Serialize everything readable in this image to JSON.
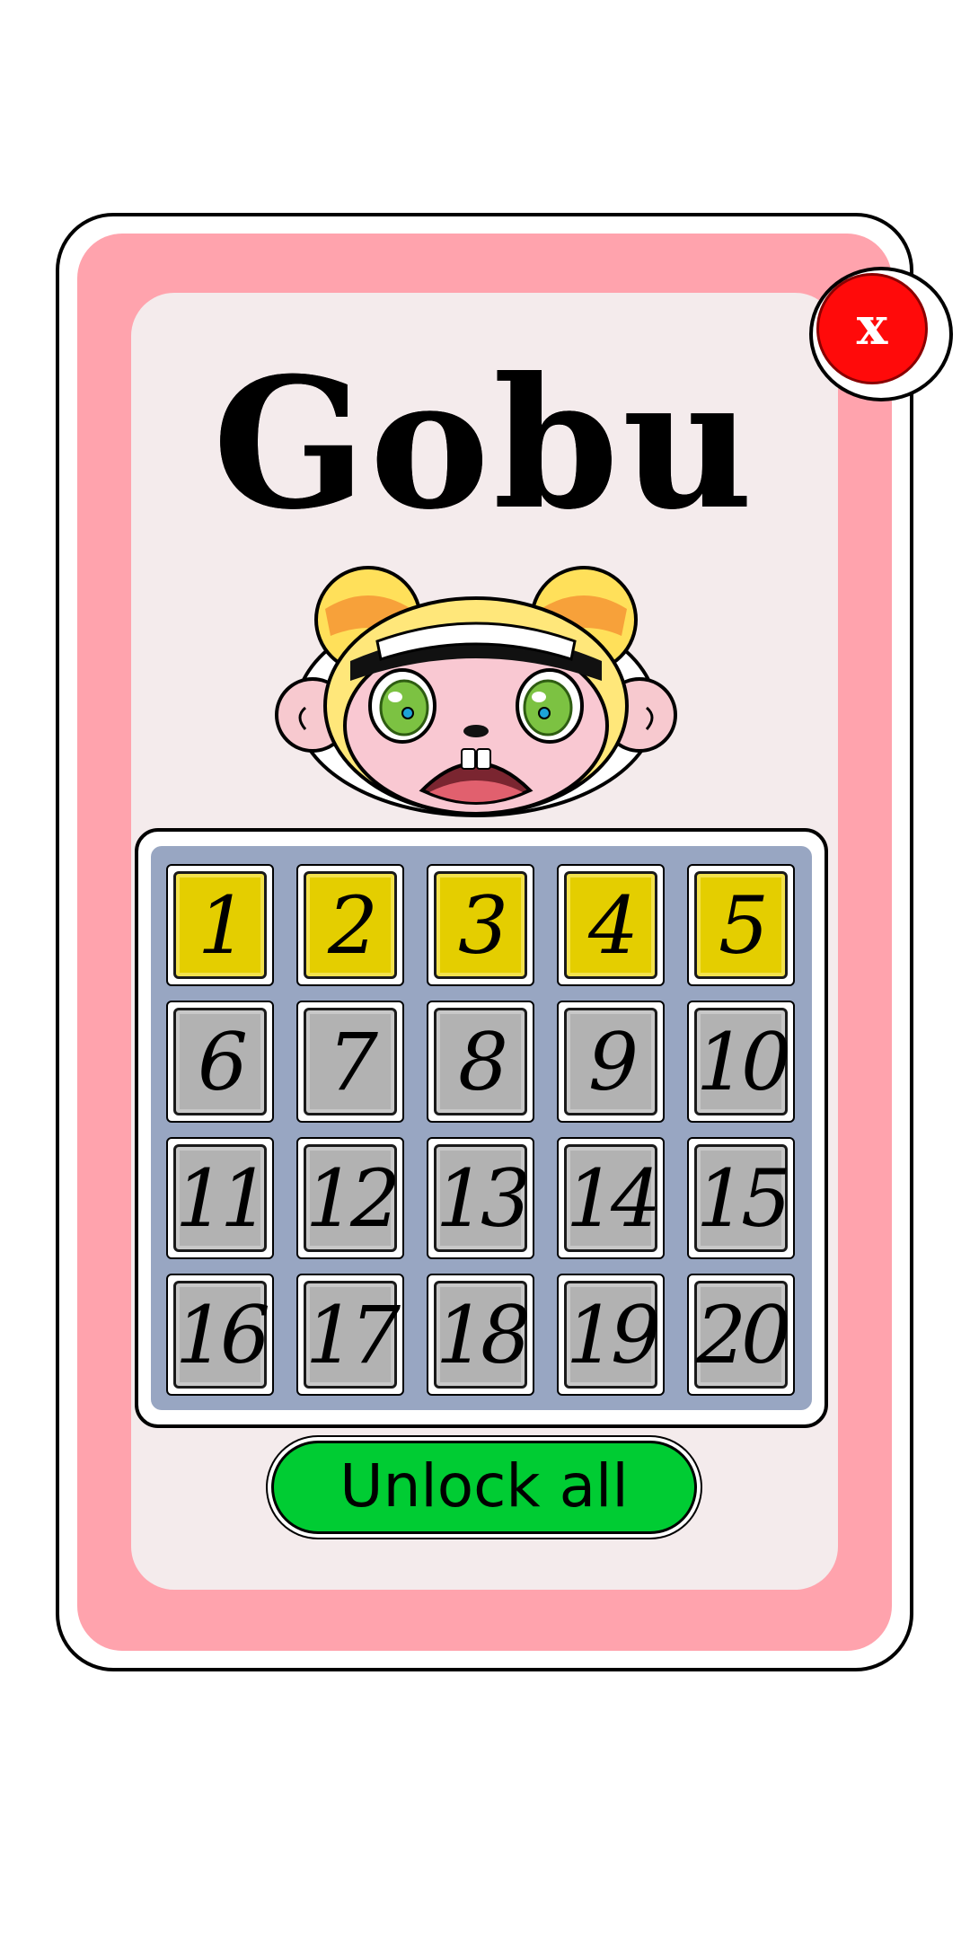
{
  "character": {
    "name": "Gobu"
  },
  "close_button": {
    "label": "x"
  },
  "levels": [
    {
      "number": "1",
      "state": "unlocked"
    },
    {
      "number": "2",
      "state": "unlocked"
    },
    {
      "number": "3",
      "state": "unlocked"
    },
    {
      "number": "4",
      "state": "unlocked"
    },
    {
      "number": "5",
      "state": "unlocked"
    },
    {
      "number": "6",
      "state": "locked"
    },
    {
      "number": "7",
      "state": "locked"
    },
    {
      "number": "8",
      "state": "locked"
    },
    {
      "number": "9",
      "state": "locked"
    },
    {
      "number": "10",
      "state": "locked"
    },
    {
      "number": "11",
      "state": "locked"
    },
    {
      "number": "12",
      "state": "locked"
    },
    {
      "number": "13",
      "state": "locked"
    },
    {
      "number": "14",
      "state": "locked"
    },
    {
      "number": "15",
      "state": "locked"
    },
    {
      "number": "16",
      "state": "locked"
    },
    {
      "number": "17",
      "state": "locked"
    },
    {
      "number": "18",
      "state": "locked"
    },
    {
      "number": "19",
      "state": "locked"
    },
    {
      "number": "20",
      "state": "locked"
    }
  ],
  "unlock_button": {
    "label": "Unlock all"
  },
  "colors": {
    "card_border": "#ffa3ad",
    "card_fill": "#f4ebec",
    "grid_fill": "#98a6c2",
    "tile_unlocked": "#e4ce00",
    "tile_locked": "#b2b2b2",
    "unlock_button": "#00cc33",
    "close_button": "#ff0a0a"
  },
  "icons": {
    "close": "close-icon",
    "portrait": "character-portrait"
  }
}
